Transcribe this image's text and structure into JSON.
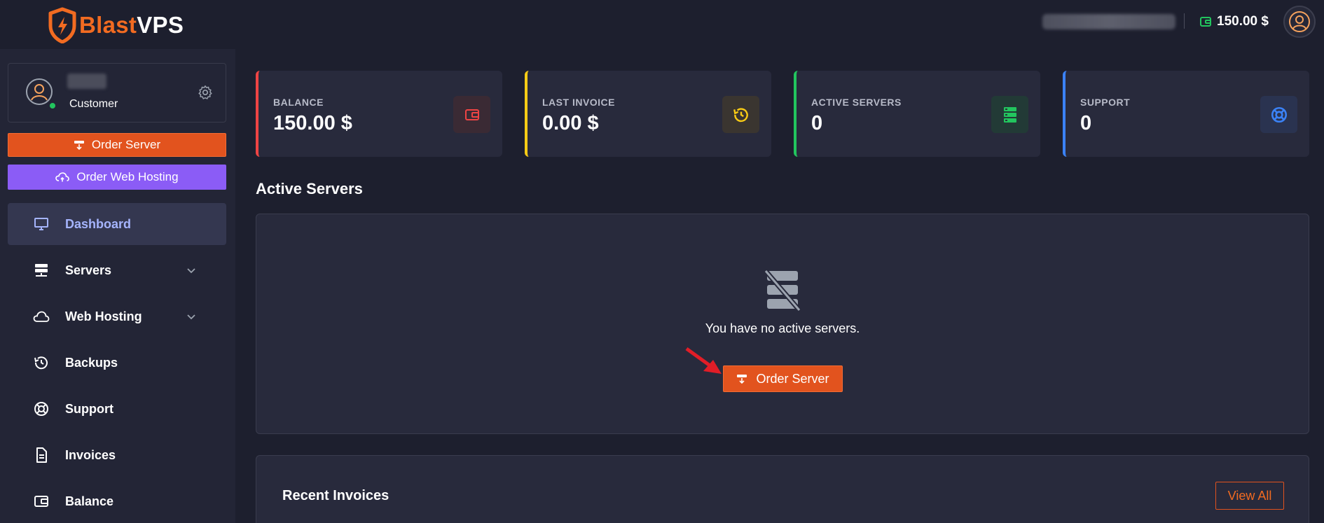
{
  "brand": {
    "name_part1": "Blast",
    "name_part2": "VPS"
  },
  "header": {
    "balance": "150.00 $"
  },
  "profile": {
    "role": "Customer"
  },
  "sidebar": {
    "order_server_label": "Order Server",
    "order_hosting_label": "Order Web Hosting",
    "items": [
      {
        "label": "Dashboard",
        "icon": "monitor-icon",
        "active": true
      },
      {
        "label": "Servers",
        "icon": "server-icon",
        "expandable": true
      },
      {
        "label": "Web Hosting",
        "icon": "cloud-icon",
        "expandable": true
      },
      {
        "label": "Backups",
        "icon": "history-icon"
      },
      {
        "label": "Support",
        "icon": "lifebuoy-icon"
      },
      {
        "label": "Invoices",
        "icon": "document-icon"
      },
      {
        "label": "Balance",
        "icon": "wallet-icon"
      }
    ]
  },
  "stats": [
    {
      "label": "BALANCE",
      "value": "150.00 $",
      "color": "#ef4444",
      "icon": "wallet-icon"
    },
    {
      "label": "LAST INVOICE",
      "value": "0.00 $",
      "color": "#facc15",
      "icon": "history-icon"
    },
    {
      "label": "ACTIVE SERVERS",
      "value": "0",
      "color": "#22c55e",
      "icon": "server-icon"
    },
    {
      "label": "SUPPORT",
      "value": "0",
      "color": "#3b82f6",
      "icon": "lifebuoy-icon"
    }
  ],
  "active_servers": {
    "title": "Active Servers",
    "empty_text": "You have no active servers.",
    "order_label": "Order Server"
  },
  "recent_invoices": {
    "title": "Recent Invoices",
    "view_all_label": "View All"
  },
  "colors": {
    "accent_orange": "#e2531e",
    "accent_purple": "#8b5cf6",
    "background": "#1d1f2e",
    "panel": "#282a3c"
  }
}
